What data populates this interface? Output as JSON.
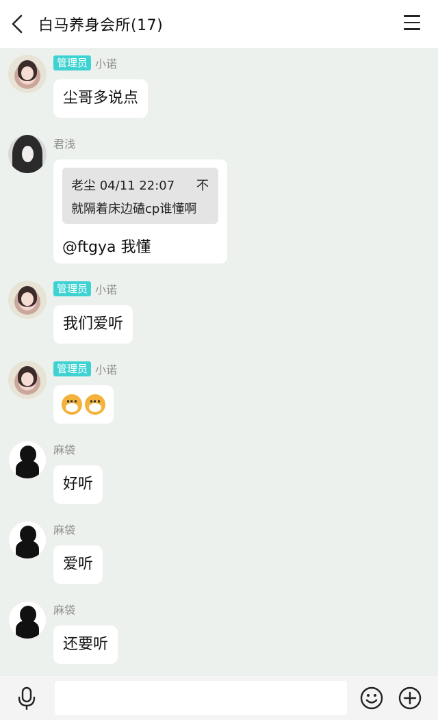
{
  "header": {
    "title": "白马养身会所(17)",
    "back_icon": "chevron-left-icon",
    "menu_icon": "hamburger-menu-icon"
  },
  "messages": [
    {
      "sender": "小诺",
      "role": "管理员",
      "text": "尘哥多说点"
    },
    {
      "sender": "君浅",
      "quote": {
        "author": "老尘",
        "time": "04/11 22:07",
        "close": "不",
        "text": "就隔着床边磕cp谁懂啊"
      },
      "text": "@ftgya 我懂"
    },
    {
      "sender": "小诺",
      "role": "管理员",
      "text": "我们爱听"
    },
    {
      "sender": "小诺",
      "role": "管理员",
      "emoji": [
        "dog-emoji",
        "dog-emoji"
      ]
    },
    {
      "sender": "麻袋",
      "text": "好听"
    },
    {
      "sender": "麻袋",
      "text": "爱听"
    },
    {
      "sender": "麻袋",
      "text": "还要听"
    }
  ],
  "toolbar": {
    "mic_icon": "microphone-icon",
    "input_value": "",
    "emoji_icon": "smiley-icon",
    "plus_icon": "plus-circle-icon"
  },
  "colors": {
    "background": "#edf1ed",
    "header": "#ffffff",
    "badge": "#3fd2d2",
    "bubble": "#ffffff",
    "quote_box": "#e4e4e4"
  }
}
